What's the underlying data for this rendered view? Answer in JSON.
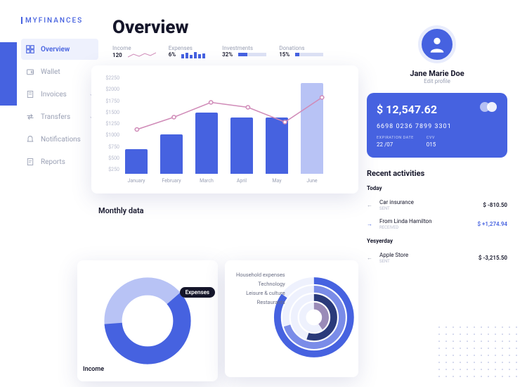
{
  "brand": "MYFINANCES",
  "nav": {
    "overview": "Overview",
    "wallet": "Wallet",
    "invoices": "Invoices",
    "transfers": "Transfers",
    "notifications": "Notifications",
    "reports": "Reports"
  },
  "page_title": "Overview",
  "stats": {
    "income": {
      "label": "Income",
      "value": "120"
    },
    "expenses": {
      "label": "Expenses",
      "value": "6%"
    },
    "investments": {
      "label": "Investments",
      "value": "32%"
    },
    "donations": {
      "label": "Donations",
      "value": "15%"
    }
  },
  "monthly_title": "Monthly data",
  "donut": {
    "expenses": "Expenses",
    "income": "Income"
  },
  "radial": {
    "household": "Household expenses",
    "technology": "Technology",
    "leisure": "Leisure & culture",
    "restaurants": "Restaurants"
  },
  "user": {
    "name": "Jane Marie Doe",
    "edit": "Edit profile"
  },
  "card": {
    "balance": "$ 12,547.62",
    "number": "6698 0236 7899 3301",
    "exp_lbl": "EXPIRATION DATE",
    "exp_val": "22 /07",
    "cvv_lbl": "CVV",
    "cvv_val": "015"
  },
  "recent": {
    "title": "Recent activities",
    "today": "Today",
    "yesterday": "Yesyerday",
    "items": [
      {
        "name": "Car insurance",
        "sub": "SENT",
        "amount": "$ -810.50"
      },
      {
        "name": "From Linda Hamilton",
        "sub": "RECEIVED",
        "amount": "$ +1,274.94"
      },
      {
        "name": "Apple Store",
        "sub": "SENT",
        "amount": "$ -3,215.50"
      }
    ]
  },
  "chart_data": {
    "bar": {
      "type": "bar",
      "categories": [
        "January",
        "February",
        "March",
        "April",
        "May",
        "June"
      ],
      "values": [
        750,
        1050,
        1500,
        1400,
        1400,
        2100
      ],
      "line_values": [
        1150,
        1400,
        1700,
        1600,
        1300,
        1800
      ],
      "ylim": [
        250,
        2250
      ],
      "y_ticks": [
        "$2250",
        "$2000",
        "$1750",
        "$1500",
        "$1250",
        "$1000",
        "$750",
        "$500",
        "$250"
      ]
    },
    "donut": {
      "type": "pie",
      "series": [
        {
          "name": "Expenses",
          "value": 60
        },
        {
          "name": "Income",
          "value": 40
        }
      ]
    },
    "radial": {
      "type": "radial",
      "series": [
        {
          "name": "Household expenses",
          "value": 85,
          "color": "#4662e0"
        },
        {
          "name": "Technology",
          "value": 70,
          "color": "#7a8ce8"
        },
        {
          "name": "Leisure & culture",
          "value": 55,
          "color": "#2a3a7a"
        },
        {
          "name": "Restaurants",
          "value": 40,
          "color": "#9a8bb8"
        }
      ]
    }
  }
}
